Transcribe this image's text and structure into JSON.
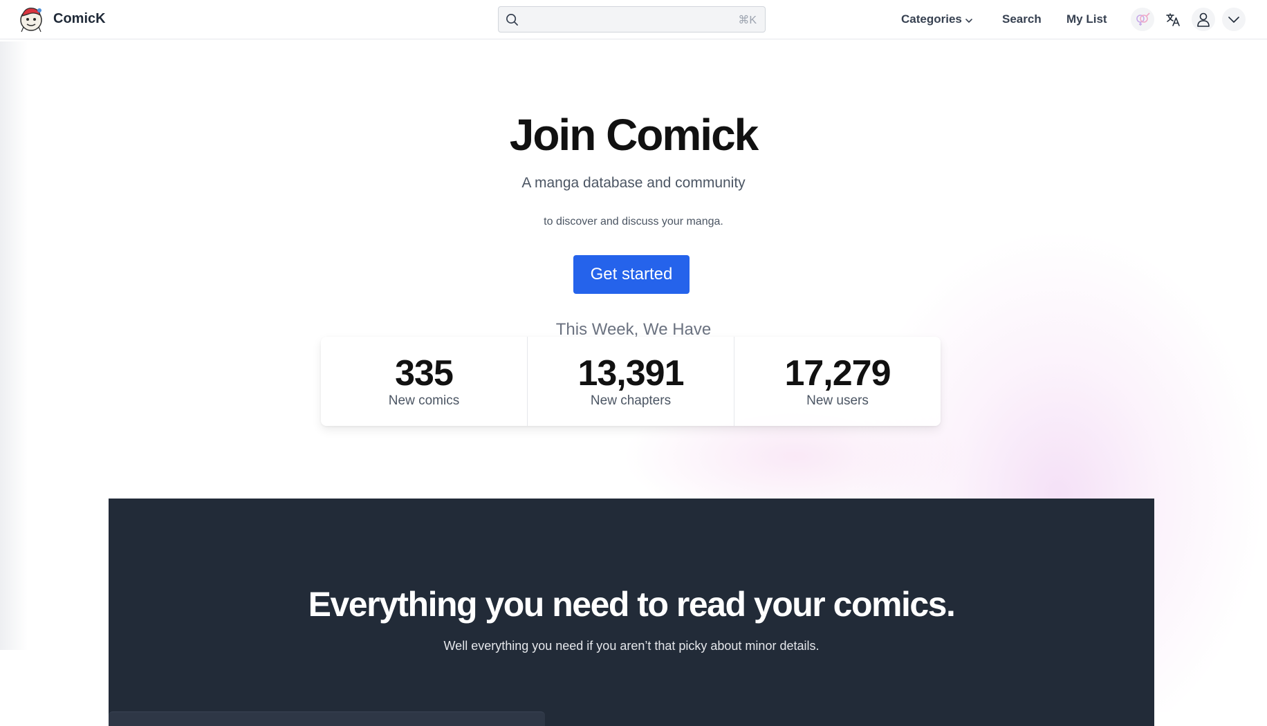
{
  "header": {
    "brand": "ComicK",
    "search": {
      "placeholder": "",
      "shortcut": "⌘K"
    },
    "nav": {
      "categories": "Categories",
      "search": "Search",
      "my_list": "My List"
    },
    "icons": [
      "gender-icon",
      "translate-icon",
      "user-icon",
      "chevron-down-icon"
    ]
  },
  "hero": {
    "title": "Join Comick",
    "subtitle": "A manga database and community",
    "subtitle2": "to discover and discuss your manga.",
    "cta": "Get started"
  },
  "stats": {
    "heading": "This Week, We Have",
    "items": [
      {
        "value": "335",
        "label": "New comics"
      },
      {
        "value": "13,391",
        "label": "New chapters"
      },
      {
        "value": "17,279",
        "label": "New users"
      }
    ]
  },
  "features": {
    "title": "Everything you need to read your comics.",
    "subtitle": "Well everything you need if you aren’t that picky about minor details."
  },
  "colors": {
    "primary": "#2563eb",
    "dark_section": "#222b38",
    "text": "#111827"
  }
}
